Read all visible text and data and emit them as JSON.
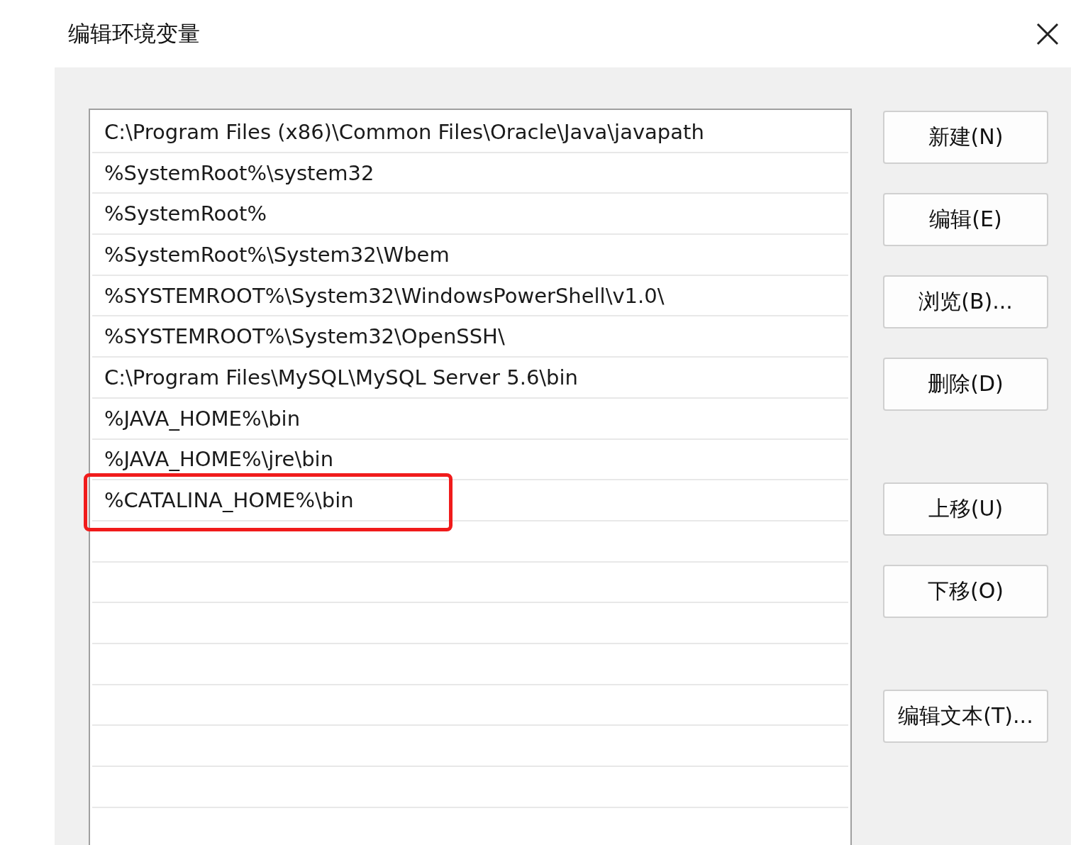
{
  "window": {
    "title": "编辑环境变量"
  },
  "paths": [
    {
      "text": "C:\\Program Files (x86)\\Common Files\\Oracle\\Java\\javapath",
      "highlighted": false
    },
    {
      "text": "%SystemRoot%\\system32",
      "highlighted": false
    },
    {
      "text": "%SystemRoot%",
      "highlighted": false
    },
    {
      "text": "%SystemRoot%\\System32\\Wbem",
      "highlighted": false
    },
    {
      "text": "%SYSTEMROOT%\\System32\\WindowsPowerShell\\v1.0\\",
      "highlighted": false
    },
    {
      "text": "%SYSTEMROOT%\\System32\\OpenSSH\\",
      "highlighted": false
    },
    {
      "text": "C:\\Program Files\\MySQL\\MySQL Server 5.6\\bin",
      "highlighted": false
    },
    {
      "text": "%JAVA_HOME%\\bin",
      "highlighted": false
    },
    {
      "text": "%JAVA_HOME%\\jre\\bin",
      "highlighted": false
    },
    {
      "text": "%CATALINA_HOME%\\bin",
      "highlighted": true
    }
  ],
  "button_groups": [
    [
      "新建(N)",
      "编辑(E)",
      "浏览(B)...",
      "删除(D)"
    ],
    [
      "上移(U)",
      "下移(O)"
    ],
    [
      "编辑文本(T)..."
    ]
  ]
}
